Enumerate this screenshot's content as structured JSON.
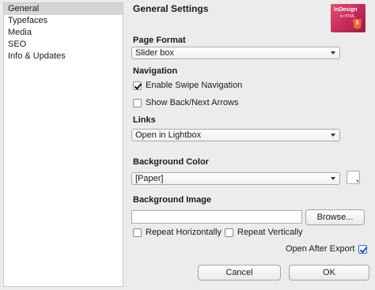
{
  "sidebar": {
    "items": [
      {
        "label": "General",
        "selected": true
      },
      {
        "label": "Typefaces",
        "selected": false
      },
      {
        "label": "Media",
        "selected": false
      },
      {
        "label": "SEO",
        "selected": false
      },
      {
        "label": "Info & Updates",
        "selected": false
      }
    ]
  },
  "header": {
    "title": "General Settings",
    "logo": {
      "text": "InDesign",
      "subtext": "to HTML",
      "badge": "5"
    }
  },
  "page_format": {
    "label": "Page Format",
    "value": "Slider box"
  },
  "navigation": {
    "label": "Navigation",
    "enable_swipe": {
      "label": "Enable Swipe Navigation",
      "checked": true
    },
    "show_arrows": {
      "label": "Show Back/Next Arrows",
      "checked": false
    }
  },
  "links": {
    "label": "Links",
    "value": "Open in Lightbox"
  },
  "background_color": {
    "label": "Background Color",
    "value": "[Paper]",
    "swatch_color": "#ffffff"
  },
  "background_image": {
    "label": "Background Image",
    "value": "",
    "browse_label": "Browse...",
    "repeat_h": {
      "label": "Repeat Horizontally",
      "checked": false
    },
    "repeat_v": {
      "label": "Repeat Vertically",
      "checked": false
    }
  },
  "open_after_export": {
    "label": "Open After Export",
    "checked": true
  },
  "footer": {
    "cancel_label": "Cancel",
    "ok_label": "OK"
  }
}
